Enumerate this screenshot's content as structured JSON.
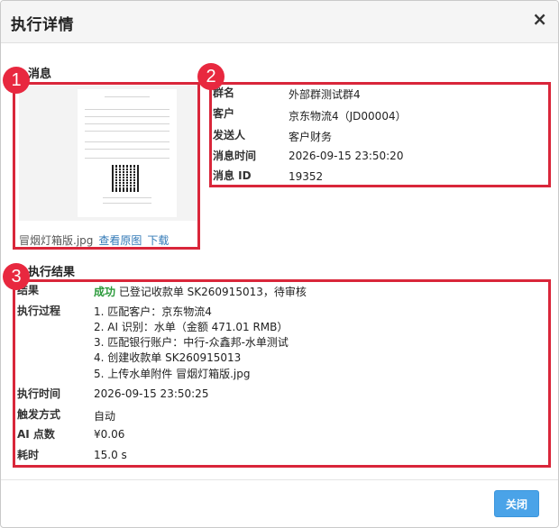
{
  "dialog": {
    "title": "执行详情",
    "close_icon": "close-icon"
  },
  "message_section": {
    "title": "消息",
    "file_name": "冒烟灯箱版.jpg",
    "view_original_label": "查看原图",
    "download_label": "下载",
    "fields": [
      {
        "label": "群名",
        "value": "外部群测试群4"
      },
      {
        "label": "客户",
        "value": "京东物流4（JD00004）"
      },
      {
        "label": "发送人",
        "value": "客户财务"
      },
      {
        "label": "消息时间",
        "value": "2026-09-15 23:50:20"
      },
      {
        "label": "消息 ID",
        "value": "19352"
      }
    ]
  },
  "result_section": {
    "title": "执行结果",
    "result_label": "结果",
    "result_status": "成功",
    "result_text": "已登记收款单 SK260915013，待审核",
    "process_label": "执行过程",
    "process_steps": [
      "1. 匹配客户：京东物流4",
      "2. AI 识别：水单（金额 471.01 RMB）",
      "3. 匹配银行账户：中行-众鑫邦-水单测试",
      "4. 创建收款单 SK260915013",
      "5. 上传水单附件 冒烟灯箱版.jpg"
    ],
    "fields": [
      {
        "label": "执行时间",
        "value": "2026-09-15 23:50:25"
      },
      {
        "label": "触发方式",
        "value": "自动"
      },
      {
        "label": "AI 点数",
        "value": "¥0.06"
      },
      {
        "label": "耗时",
        "value": "15.0 s"
      }
    ]
  },
  "annotations": [
    "1",
    "2",
    "3"
  ],
  "footer": {
    "close_button_label": "关闭"
  },
  "colors": {
    "annotation_red": "#d9263a",
    "success_green": "#2a9a3a",
    "button_blue": "#4aa3e8",
    "link_blue": "#337ab7"
  }
}
